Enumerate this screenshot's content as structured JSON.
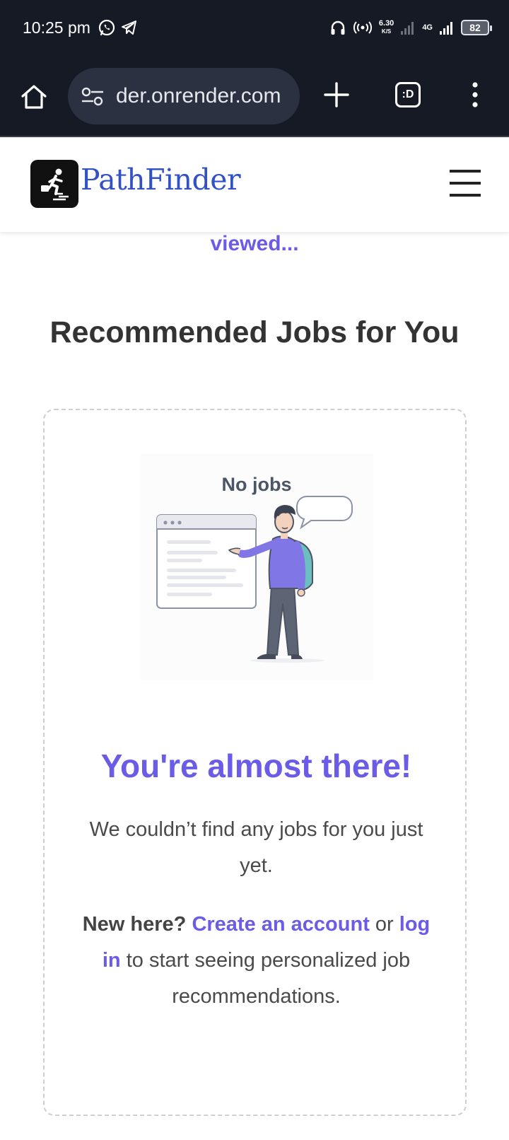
{
  "status_bar": {
    "time": "10:25 pm",
    "net_speed": "6.30",
    "net_speed_unit": "K/S",
    "network_type": "4G",
    "battery": "82",
    "icons": [
      "whatsapp-icon",
      "telegram-icon",
      "headphones-icon",
      "hotspot-icon",
      "signal-icon"
    ]
  },
  "browser": {
    "url": "der.onrender.com",
    "tab_switcher_label": ":D",
    "icons": [
      "home-icon",
      "site-settings-icon",
      "plus-icon",
      "more-vert-icon"
    ]
  },
  "site": {
    "brand": "PathFinder",
    "logo_icon": "runner-logo-icon",
    "menu_icon": "hamburger-menu-icon",
    "colors": {
      "accent": "#6b5ce7",
      "brand": "#3251c7",
      "heading": "#333333"
    }
  },
  "main": {
    "truncated_link": "viewed...",
    "section_title": "Recommended Jobs for You",
    "empty_state": {
      "illustration_label": "No jobs",
      "heading": "You're almost there!",
      "description": "We couldn’t find any jobs for you just yet.",
      "cta_prefix": "New here?",
      "cta_create": "Create an account",
      "cta_or": "or",
      "cta_login": "log in",
      "cta_suffix": "to start seeing personalized job recommendations."
    }
  }
}
